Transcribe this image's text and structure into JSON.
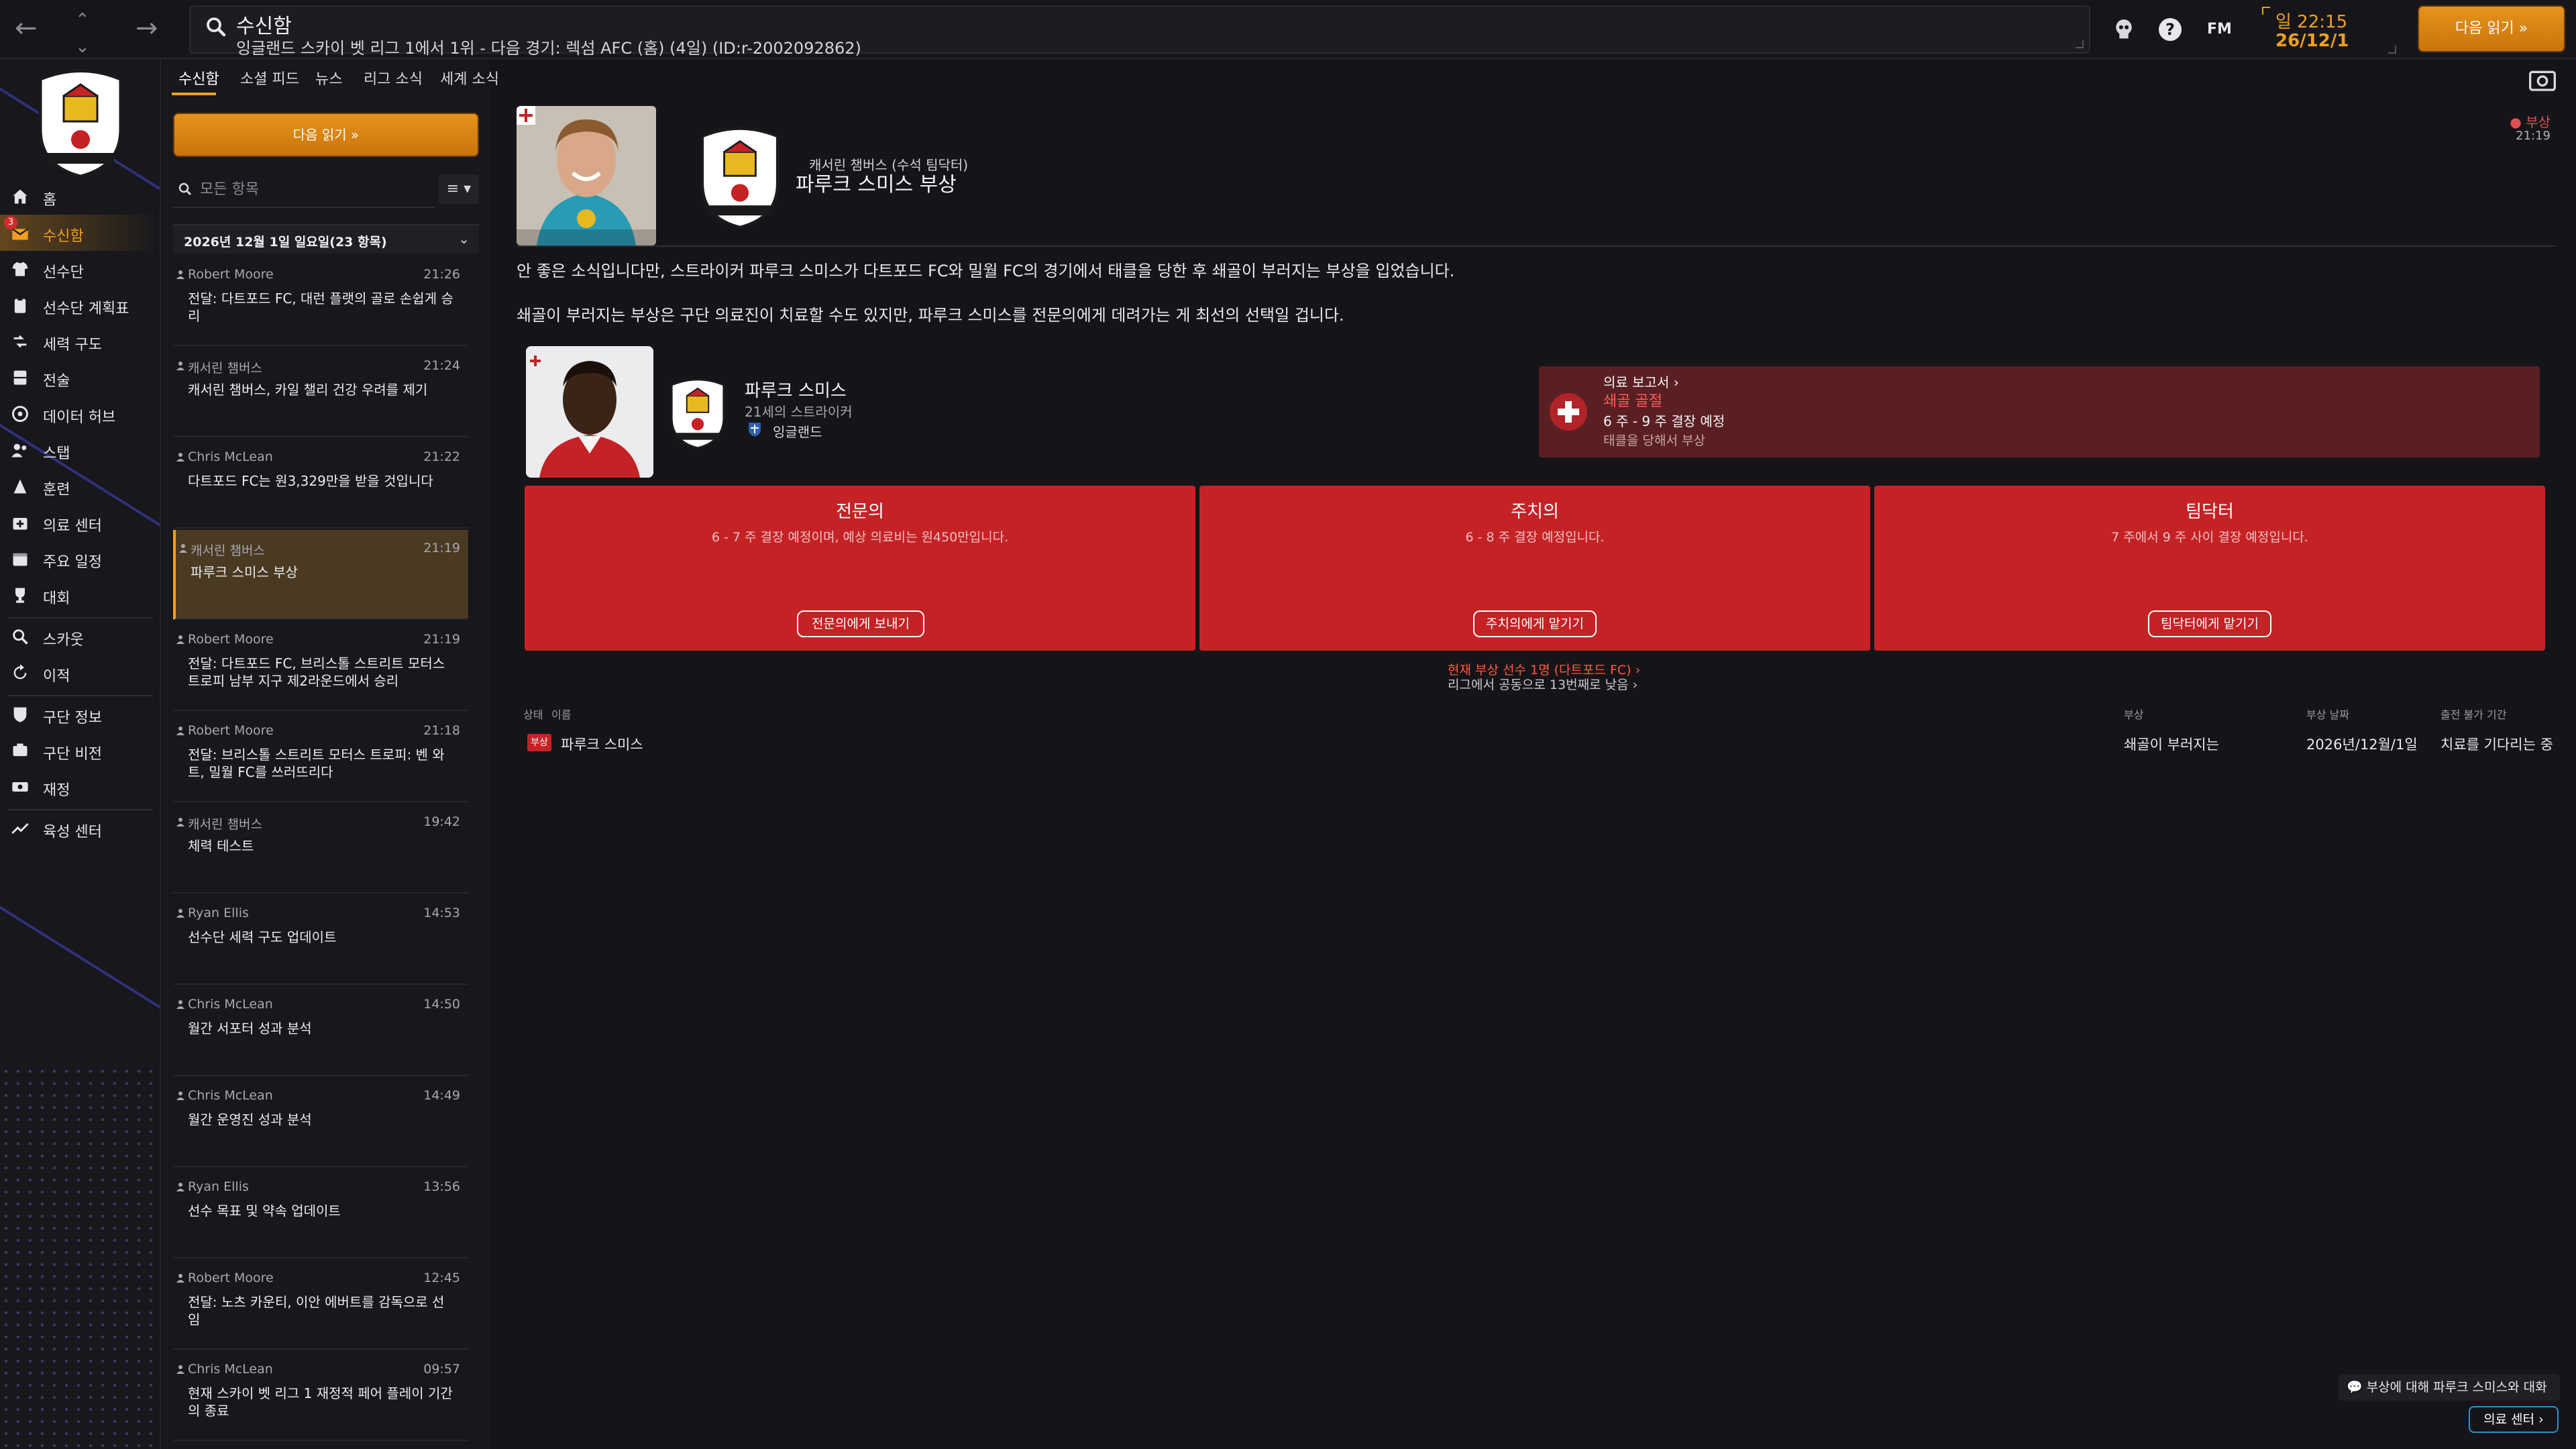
{
  "topbar": {
    "title": "수신함",
    "subtitle": "잉글랜드 스카이 벳 리그 1에서 1위 - 다음 경기: 렉섬 AFC (홈) (4일) (ID:r-2002092862)",
    "time": "일 22:15",
    "date": "26/12/1",
    "fm_logo": "FM",
    "help": "?",
    "continue_label": "다음 읽기 »"
  },
  "sidebar": {
    "inbox_badge": "3",
    "items": [
      {
        "label": "홈",
        "icon": "home-icon"
      },
      {
        "label": "수신함",
        "icon": "inbox-icon"
      },
      {
        "label": "선수단",
        "icon": "shirt-icon"
      },
      {
        "label": "선수단 계획표",
        "icon": "clipboard-icon"
      },
      {
        "label": "세력 구도",
        "icon": "dynamics-icon"
      },
      {
        "label": "전술",
        "icon": "tactics-icon"
      },
      {
        "label": "데이터 허브",
        "icon": "data-hub-icon"
      },
      {
        "label": "스탭",
        "icon": "staff-icon"
      },
      {
        "label": "훈련",
        "icon": "training-icon"
      },
      {
        "label": "의료 센터",
        "icon": "medical-icon"
      },
      {
        "label": "주요 일정",
        "icon": "calendar-icon"
      },
      {
        "label": "대회",
        "icon": "trophy-icon"
      },
      {
        "label": "스카웃",
        "icon": "scout-icon"
      },
      {
        "label": "이적",
        "icon": "transfer-icon"
      },
      {
        "label": "구단 정보",
        "icon": "club-info-icon"
      },
      {
        "label": "구단 비전",
        "icon": "vision-icon"
      },
      {
        "label": "재정",
        "icon": "finance-icon"
      },
      {
        "label": "육성 센터",
        "icon": "development-icon"
      }
    ]
  },
  "inbox": {
    "tabs": [
      "수신함",
      "소셜 피드",
      "뉴스",
      "리그 소식",
      "세계 소식"
    ],
    "continue_label": "다음 읽기 »",
    "search_placeholder": "모든 항목",
    "filter_label": "≡ ▾",
    "date_group": "2026년 12월 1일 일요일(23 항목)",
    "messages": [
      {
        "sender": "Robert Moore",
        "time": "21:26",
        "subject": "전달: 다트포드 FC, 대런 플랫의 골로 손쉽게 승리"
      },
      {
        "sender": "캐서린 챔버스",
        "time": "21:24",
        "subject": "캐서린 챔버스, 카일 챌리 건강 우려를 제기"
      },
      {
        "sender": "Chris McLean",
        "time": "21:22",
        "subject": "다트포드 FC는 원3,329만을 받을 것입니다"
      },
      {
        "sender": "캐서린 챔버스",
        "time": "21:19",
        "subject": "파루크 스미스 부상"
      },
      {
        "sender": "Robert Moore",
        "time": "21:19",
        "subject": "전달: 다트포드 FC, 브리스톨 스트리트 모터스 트로피 남부 지구 제2라운드에서 승리"
      },
      {
        "sender": "Robert Moore",
        "time": "21:18",
        "subject": "전달: 브리스톨 스트리트 모터스 트로피: 벤 와트, 밀월 FC를 쓰러뜨리다"
      },
      {
        "sender": "캐서린 챔버스",
        "time": "19:42",
        "subject": "체력 테스트"
      },
      {
        "sender": "Ryan Ellis",
        "time": "14:53",
        "subject": "선수단 세력 구도 업데이트"
      },
      {
        "sender": "Chris McLean",
        "time": "14:50",
        "subject": "월간 서포터 성과 분석"
      },
      {
        "sender": "Chris McLean",
        "time": "14:49",
        "subject": "월간 운영진 성과 분석"
      },
      {
        "sender": "Ryan Ellis",
        "time": "13:56",
        "subject": "선수 목표 및 약속 업데이트"
      },
      {
        "sender": "Robert Moore",
        "time": "12:45",
        "subject": "전달: 노츠 카운티, 이안 에버트를 감독으로 선임"
      },
      {
        "sender": "Chris McLean",
        "time": "09:57",
        "subject": "현재 스카이 벳 리그 1 재정적 페어 플레이 기간의 종료"
      }
    ]
  },
  "message": {
    "from": "캐서린 챔버스 (수석 팀닥터)",
    "title": "파루크 스미스 부상",
    "sender_photo_caption": "CATHERINE CHAMBERS",
    "tag": "부상",
    "tag_time": "21:19",
    "para1": "안 좋은 소식입니다만, 스트라이커 파루크 스미스가 다트포드 FC와 밀월 FC의 경기에서 태클을 당한 후 쇄골이 부러지는 부상을 입었습니다.",
    "para2": "쇄골이 부러지는 부상은 구단 의료진이 치료할 수도 있지만, 파루크 스미스를 전문의에게 데려가는 게 최선의 선택일 겁니다.",
    "player": {
      "name": "파루크 스미스",
      "desc": "21세의 스트라이커",
      "nation": "잉글랜드",
      "photo_caption": "FAROUK SMITH"
    },
    "medical_report": {
      "title": "의료 보고서 ›",
      "injury": "쇄골 골절",
      "duration": "6 주 - 9 주 결장 예정",
      "cause": "태클을 당해서 부상"
    },
    "options": [
      {
        "title": "전문의",
        "desc": "6 - 7 주 결장 예정이며, 예상 의료비는 원450만입니다.",
        "button": "전문의에게 보내기"
      },
      {
        "title": "주치의",
        "desc": "6 - 8 주 결장 예정입니다.",
        "button": "주치의에게 맡기기"
      },
      {
        "title": "팀닥터",
        "desc": "7 주에서 9 주 사이 결장 예정입니다.",
        "button": "팀닥터에게 맡기기"
      }
    ],
    "summary1": "현재 부상 선수 1명 (다트포드 FC) ›",
    "summary2": "리그에서 공동으로 13번째로 낮음 ›",
    "table": {
      "headers": [
        "상태",
        "이름",
        "부상",
        "부상 날짜",
        "출전 불가 기간"
      ],
      "row": {
        "status": "부상",
        "name": "파루크 스미스",
        "injury": "쇄골이 부러지는",
        "date": "2026년/12월/1일",
        "period": "치료를 기다리는 중"
      }
    },
    "discuss_button": "부상에 대해 파루크 스미스와 대화",
    "med_center_button": "의료 센터 ›"
  },
  "colors": {
    "accent": "#f0a020",
    "injury_red": "#c52226",
    "report_bg": "#5a1f22",
    "link_blue": "#2f8fd0"
  }
}
